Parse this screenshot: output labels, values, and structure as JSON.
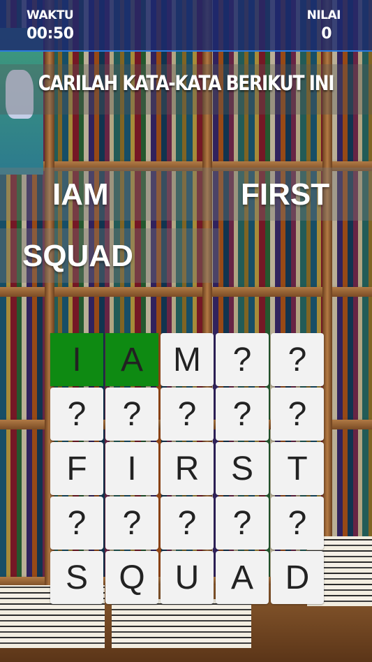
{
  "hud": {
    "timer_label": "WAKTU",
    "timer_value": "00:50",
    "score_label": "NILAI",
    "score_value": "0"
  },
  "prompt": "CARILAH KATA-KATA BERIKUT INI",
  "words": [
    "IAM",
    "FIRST",
    "SQUAD"
  ],
  "grid": [
    [
      "I",
      "A",
      "M",
      "?",
      "?"
    ],
    [
      "?",
      "?",
      "?",
      "?",
      "?"
    ],
    [
      "F",
      "I",
      "R",
      "S",
      "T"
    ],
    [
      "?",
      "?",
      "?",
      "?",
      "?"
    ],
    [
      "S",
      "Q",
      "U",
      "A",
      "D"
    ]
  ],
  "found_cells": [
    [
      0,
      0
    ],
    [
      0,
      1
    ]
  ],
  "colors": {
    "hud_bg": "#1c2a6e",
    "found_cell": "#0e8a12",
    "cell": "#f2f2f2"
  }
}
